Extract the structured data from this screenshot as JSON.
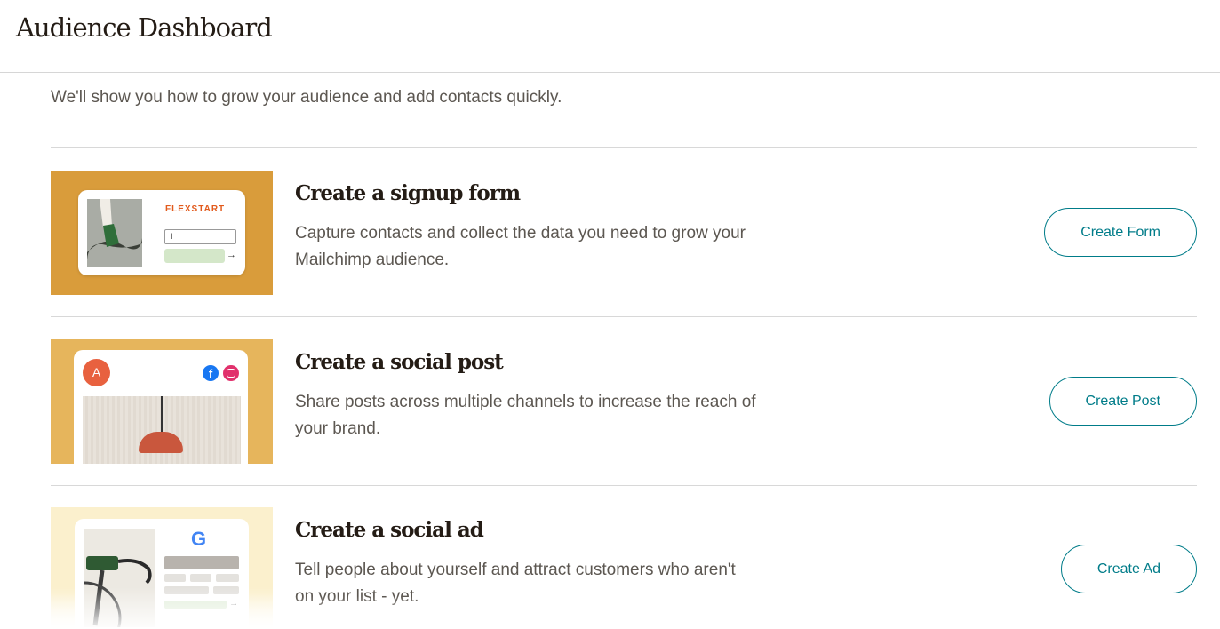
{
  "header": {
    "title": "Audience Dashboard"
  },
  "intro": "We'll show you how to grow your audience and add contacts quickly.",
  "cards": [
    {
      "title": "Create a signup form",
      "description": "Capture contacts and collect the data you need to grow your Mailchimp audience.",
      "button": "Create Form",
      "thumb": {
        "brand": "FLEXSTART",
        "field_value": "I",
        "arrow": "→"
      }
    },
    {
      "title": "Create a social post",
      "description": "Share posts across multiple channels to increase the reach of your brand.",
      "button": "Create Post",
      "thumb": {
        "avatar_letter": "A",
        "facebook_glyph": "f"
      }
    },
    {
      "title": "Create a social ad",
      "description": "Tell people about yourself and attract customers who aren't on your list - yet.",
      "button": "Create Ad",
      "thumb": {
        "google_glyph": "G",
        "arrow": "→"
      }
    }
  ],
  "colors": {
    "accent": "#007c89",
    "thumb1_bg": "#d99c3b",
    "thumb2_bg": "#e6b55c",
    "thumb3_bg": "#fbf0cd",
    "brand_orange": "#e25a1c"
  }
}
